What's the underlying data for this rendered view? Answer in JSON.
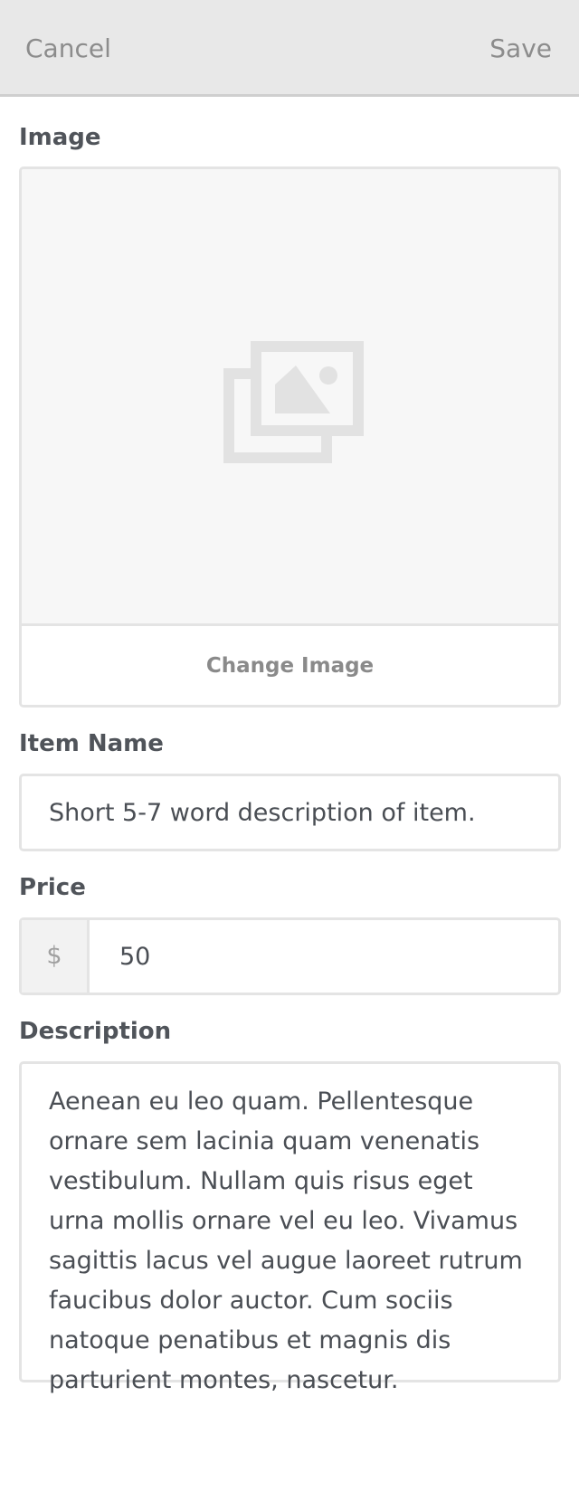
{
  "header": {
    "cancel_label": "Cancel",
    "save_label": "Save"
  },
  "image_section": {
    "label": "Image",
    "change_button_label": "Change Image",
    "placeholder_icon": "image-placeholder-icon"
  },
  "item_name": {
    "label": "Item Name",
    "value": "Short 5-7 word description of item."
  },
  "price": {
    "label": "Price",
    "currency_symbol": "$",
    "value": "50"
  },
  "description": {
    "label": "Description",
    "value": "Aenean eu leo quam. Pellentesque ornare sem lacinia quam venenatis vestibulum. Nullam quis risus eget urna mollis ornare vel eu leo. Vivamus sagittis lacus vel augue laoreet rutrum faucibus dolor auctor. Cum sociis natoque penatibus et magnis dis parturient montes, nascetur."
  },
  "colors": {
    "header_bg": "#e8e8e8",
    "border": "#e4e4e4",
    "muted_text": "#8c8c8c",
    "label_text": "#50545a"
  }
}
